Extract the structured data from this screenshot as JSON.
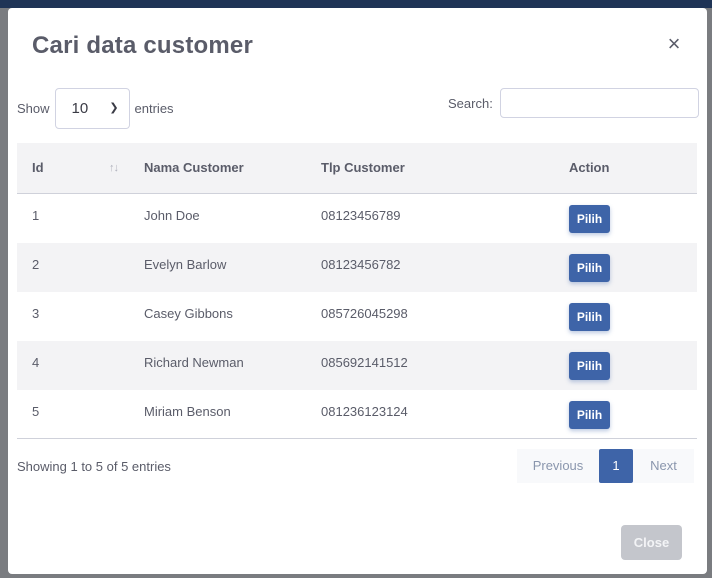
{
  "modal": {
    "title": "Cari data customer",
    "close_icon": "×",
    "close_button": "Close"
  },
  "length": {
    "prefix": "Show",
    "value": "10",
    "suffix": "entries"
  },
  "search": {
    "label": "Search:",
    "value": ""
  },
  "table": {
    "columns": [
      "Id",
      "Nama Customer",
      "Tlp Customer",
      "Action"
    ],
    "sort_icon": "↑↓",
    "rows": [
      {
        "id": "1",
        "name": "John Doe",
        "phone": "08123456789",
        "action": "Pilih"
      },
      {
        "id": "2",
        "name": "Evelyn Barlow",
        "phone": "08123456782",
        "action": "Pilih"
      },
      {
        "id": "3",
        "name": "Casey Gibbons",
        "phone": "085726045298",
        "action": "Pilih"
      },
      {
        "id": "4",
        "name": "Richard Newman",
        "phone": "085692141512",
        "action": "Pilih"
      },
      {
        "id": "5",
        "name": "Miriam Benson",
        "phone": "081236123124",
        "action": "Pilih"
      }
    ]
  },
  "info": "Showing 1 to 5 of 5 entries",
  "pagination": {
    "previous": "Previous",
    "current": "1",
    "next": "Next"
  },
  "colors": {
    "primary": "#3e64a8",
    "text": "#5a5c69",
    "stripe": "#f3f3f5"
  }
}
